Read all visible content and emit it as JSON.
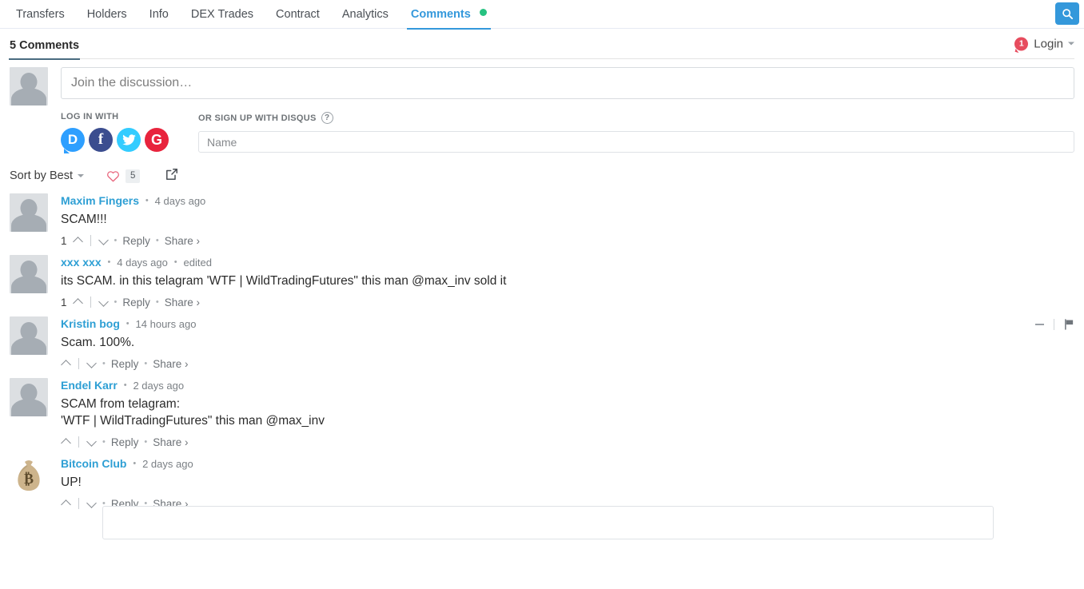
{
  "topnav": {
    "tabs": [
      {
        "label": "Transfers",
        "active": false,
        "dot": false
      },
      {
        "label": "Holders",
        "active": false,
        "dot": false
      },
      {
        "label": "Info",
        "active": false,
        "dot": false
      },
      {
        "label": "DEX Trades",
        "active": false,
        "dot": false
      },
      {
        "label": "Contract",
        "active": false,
        "dot": false
      },
      {
        "label": "Analytics",
        "active": false,
        "dot": false
      },
      {
        "label": "Comments",
        "active": true,
        "dot": true
      }
    ],
    "search_icon": "search-icon",
    "accent_color": "#3498db",
    "dot_color": "#26c281"
  },
  "disqus_header": {
    "comment_count_label": "5 Comments",
    "login_badge": "1",
    "login_label": "Login",
    "badge_color": "#e74c5e"
  },
  "composer": {
    "avatar": "default-avatar",
    "comment_placeholder": "Join the discussion…",
    "comment_value": "",
    "login_with_label": "LOG IN WITH",
    "social_buttons": [
      {
        "name": "disqus",
        "glyph": "D"
      },
      {
        "name": "facebook",
        "glyph": "f"
      },
      {
        "name": "twitter",
        "glyph": "🐦"
      },
      {
        "name": "google",
        "glyph": "G"
      }
    ],
    "signup_label": "OR SIGN UP WITH DISQUS",
    "help_glyph": "?",
    "name_placeholder": "Name",
    "name_value": ""
  },
  "sortbar": {
    "sort_label": "Sort by Best",
    "favorite_icon": "heart-icon",
    "favorite_count": "5",
    "share_icon": "share-icon"
  },
  "comments": [
    {
      "author": "Maxim Fingers",
      "time": "4 days ago",
      "edited": "",
      "text": "SCAM!!!",
      "vote_count": "1",
      "reply_label": "Reply",
      "share_label": "Share ›",
      "avatar": "default-avatar"
    },
    {
      "author": "xxx xxx",
      "time": "4 days ago",
      "edited": "edited",
      "text": "its SCAM. in this telagram 'WTF | WildTradingFutures\" this man @max_inv sold it",
      "vote_count": "1",
      "reply_label": "Reply",
      "share_label": "Share ›",
      "avatar": "default-avatar"
    },
    {
      "author": "Kristin bog",
      "time": "14 hours ago",
      "edited": "",
      "text": "Scam. 100%.",
      "vote_count": "",
      "reply_label": "Reply",
      "share_label": "Share ›",
      "avatar": "default-avatar",
      "tools": {
        "collapse_icon": "minus-icon",
        "flag_icon": "flag-icon"
      }
    },
    {
      "author": "Endel Karr",
      "time": "2 days ago",
      "edited": "",
      "text": "SCAM from telagram:\n'WTF | WildTradingFutures\" this man @max_inv",
      "vote_count": "",
      "reply_label": "Reply",
      "share_label": "Share ›",
      "avatar": "default-avatar"
    },
    {
      "author": "Bitcoin Club",
      "time": "2 days ago",
      "edited": "",
      "text": "UP!",
      "vote_count": "",
      "reply_label": "Reply",
      "share_label": "Share ›",
      "avatar": "money-bag-avatar"
    }
  ]
}
